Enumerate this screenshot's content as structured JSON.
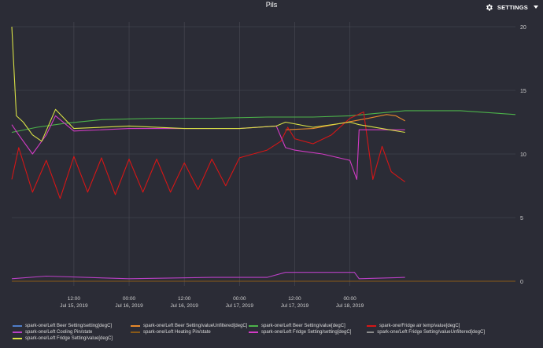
{
  "header": {
    "title": "Pils",
    "settings_label": "SETTINGS"
  },
  "chart_data": {
    "type": "line",
    "title": "Pils",
    "ylim": [
      0,
      20
    ],
    "y_ticks": [
      0,
      5,
      10,
      15,
      20
    ],
    "y_tick_labels": [
      "0",
      "5",
      "10",
      "15",
      "20"
    ],
    "x_range": [
      "2019-07-14 22:30",
      "2019-07-19 12:00"
    ],
    "x_ticks": [
      "2019-07-15 12:00",
      "2019-07-16 00:00",
      "2019-07-16 12:00",
      "2019-07-17 00:00",
      "2019-07-17 12:00",
      "2019-07-18 00:00"
    ],
    "x_tick_labels": [
      [
        "12:00",
        "Jul 15, 2019"
      ],
      [
        "00:00",
        "Jul 16, 2019"
      ],
      [
        "12:00",
        "Jul 16, 2019"
      ],
      [
        "00:00",
        "Jul 17, 2019"
      ],
      [
        "12:00",
        "Jul 17, 2019"
      ],
      [
        "00:00",
        "Jul 18, 2019"
      ]
    ],
    "grid": true,
    "legend_position": "bottom",
    "series": [
      {
        "name": "spark-one/Left Beer Setting/setting[degC]",
        "color": "#4f7ec9",
        "x": [],
        "y": []
      },
      {
        "name": "spark-one/Left Beer Setting/valueUnfiltered[degC]",
        "color": "#e8892b",
        "x": [
          "2019-07-17 10:00",
          "2019-07-17 16:00",
          "2019-07-17 22:00",
          "2019-07-18 04:00",
          "2019-07-18 08:00",
          "2019-07-18 10:00",
          "2019-07-18 12:00"
        ],
        "y": [
          11.9,
          12.0,
          12.4,
          12.8,
          13.1,
          13.0,
          12.6
        ]
      },
      {
        "name": "spark-one/Left Beer Setting/value[degC]",
        "color": "#4cb34a",
        "x": [
          "2019-07-14 22:30",
          "2019-07-15 04:00",
          "2019-07-15 10:00",
          "2019-07-15 18:00",
          "2019-07-16 06:00",
          "2019-07-16 18:00",
          "2019-07-17 06:00",
          "2019-07-17 16:00",
          "2019-07-18 00:00",
          "2019-07-18 06:00",
          "2019-07-18 12:00",
          "2019-07-19 00:00",
          "2019-07-19 12:00"
        ],
        "y": [
          11.7,
          12.1,
          12.4,
          12.7,
          12.8,
          12.8,
          12.9,
          12.9,
          13.0,
          13.2,
          13.4,
          13.4,
          13.1
        ]
      },
      {
        "name": "spark-one/Fridge air temp/value[degC]",
        "color": "#d61616",
        "x": [
          "2019-07-14 22:30",
          "2019-07-15 00:00",
          "2019-07-15 03:00",
          "2019-07-15 06:00",
          "2019-07-15 09:00",
          "2019-07-15 12:00",
          "2019-07-15 15:00",
          "2019-07-15 18:00",
          "2019-07-15 21:00",
          "2019-07-16 00:00",
          "2019-07-16 03:00",
          "2019-07-16 06:00",
          "2019-07-16 09:00",
          "2019-07-16 12:00",
          "2019-07-16 15:00",
          "2019-07-16 18:00",
          "2019-07-16 21:00",
          "2019-07-17 00:00",
          "2019-07-17 03:00",
          "2019-07-17 06:00",
          "2019-07-17 09:00",
          "2019-07-17 10:30",
          "2019-07-17 12:00",
          "2019-07-17 16:00",
          "2019-07-17 20:00",
          "2019-07-18 00:00",
          "2019-07-18 03:00",
          "2019-07-18 05:00",
          "2019-07-18 07:00",
          "2019-07-18 09:00",
          "2019-07-18 12:00"
        ],
        "y": [
          8.0,
          10.5,
          7.0,
          9.5,
          6.5,
          9.8,
          7.0,
          9.7,
          6.8,
          9.6,
          7.0,
          9.6,
          7.0,
          9.3,
          7.2,
          9.6,
          7.5,
          9.7,
          10.0,
          10.3,
          11.0,
          12.1,
          11.2,
          10.8,
          11.5,
          12.8,
          13.3,
          8.0,
          10.6,
          8.6,
          7.8
        ]
      },
      {
        "name": "spark-one/Left Cooling Pin/state",
        "color": "#b940c5",
        "x": [
          "2019-07-14 22:30",
          "2019-07-15 06:00",
          "2019-07-16 00:00",
          "2019-07-16 18:00",
          "2019-07-17 06:00",
          "2019-07-17 10:00",
          "2019-07-17 22:00",
          "2019-07-18 01:00",
          "2019-07-18 02:00",
          "2019-07-18 12:00"
        ],
        "y": [
          0.2,
          0.4,
          0.2,
          0.3,
          0.3,
          0.7,
          0.7,
          0.7,
          0.2,
          0.3
        ]
      },
      {
        "name": "spark-one/Left Heating Pin/state",
        "color": "#8a5a18",
        "x": [
          "2019-07-14 22:30",
          "2019-07-19 12:00"
        ],
        "y": [
          0,
          0
        ]
      },
      {
        "name": "spark-one/Left Fridge Setting/setting[degC]",
        "color": "#d23bc5",
        "x": [
          "2019-07-14 22:30",
          "2019-07-15 00:00",
          "2019-07-15 03:00",
          "2019-07-15 06:00",
          "2019-07-15 08:00",
          "2019-07-15 12:00",
          "2019-07-16 00:00",
          "2019-07-16 12:00",
          "2019-07-17 00:00",
          "2019-07-17 08:00",
          "2019-07-17 10:00",
          "2019-07-17 12:00",
          "2019-07-17 18:00",
          "2019-07-18 00:00",
          "2019-07-18 01:30",
          "2019-07-18 02:00",
          "2019-07-18 12:00"
        ],
        "y": [
          12.3,
          11.5,
          10.0,
          11.5,
          13.0,
          11.8,
          12.0,
          12.0,
          12.0,
          12.2,
          10.5,
          10.3,
          10.0,
          9.5,
          8.0,
          11.9,
          11.9
        ]
      },
      {
        "name": "spark-one/Left Fridge Setting/valueUnfiltered[degC]",
        "color": "#8c8c8c",
        "x": [],
        "y": []
      },
      {
        "name": "spark-one/Left Fridge Setting/value[degC]",
        "color": "#d8e046",
        "x": [
          "2019-07-14 22:30",
          "2019-07-14 23:30",
          "2019-07-15 01:00",
          "2019-07-15 03:00",
          "2019-07-15 05:00",
          "2019-07-15 08:00",
          "2019-07-15 12:00",
          "2019-07-16 00:00",
          "2019-07-16 12:00",
          "2019-07-17 00:00",
          "2019-07-17 08:00",
          "2019-07-17 10:00",
          "2019-07-17 16:00",
          "2019-07-18 00:00",
          "2019-07-18 02:00",
          "2019-07-18 12:00"
        ],
        "y": [
          20.0,
          13.0,
          12.5,
          11.5,
          11.0,
          13.5,
          12.0,
          12.2,
          12.0,
          12.0,
          12.2,
          12.5,
          12.1,
          12.5,
          12.3,
          11.7
        ]
      }
    ]
  }
}
